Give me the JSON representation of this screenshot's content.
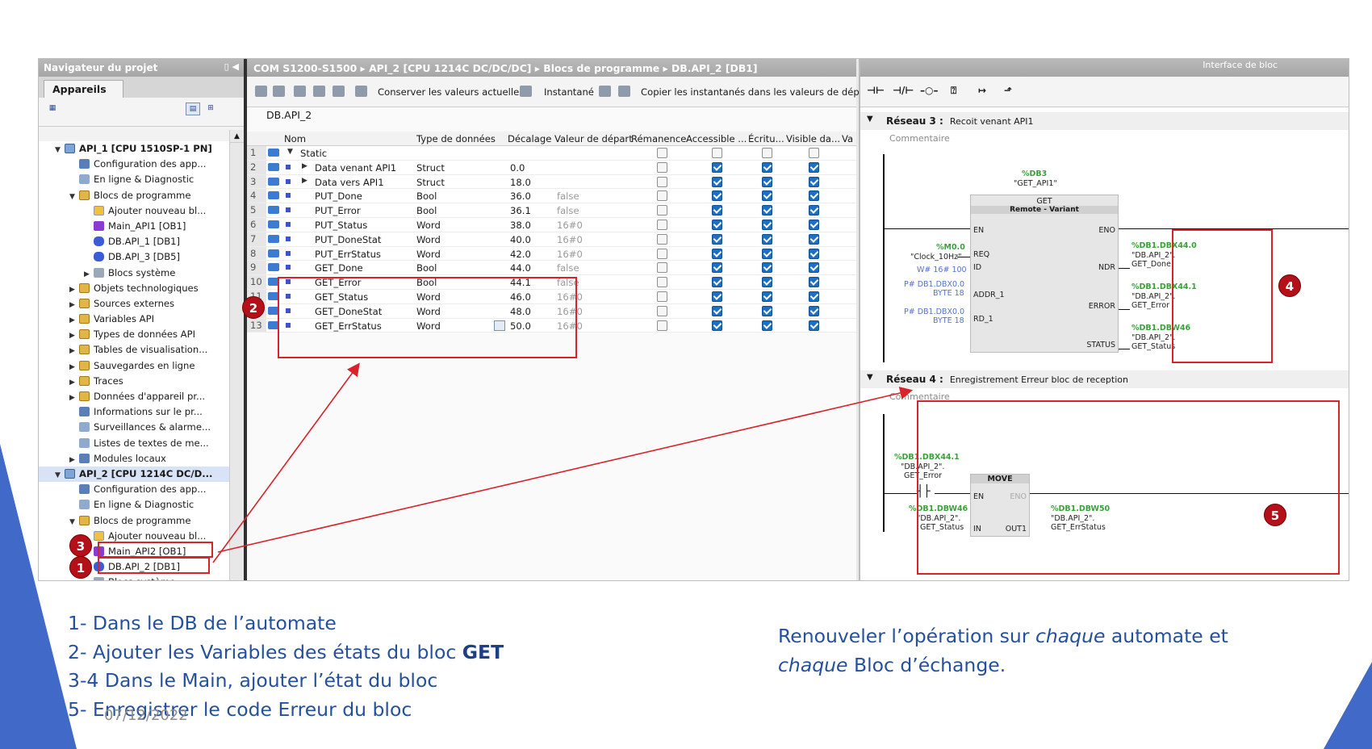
{
  "navigator": {
    "header": "Navigateur du projet",
    "tab": "Appareils",
    "tree": [
      {
        "label": "API_1 [CPU 1510SP-1 PN]",
        "level": 0,
        "icon": "cpu",
        "twisty": "▼"
      },
      {
        "label": "Configuration des app...",
        "level": 1,
        "icon": "cfg",
        "twisty": ""
      },
      {
        "label": "En ligne & Diagnostic",
        "level": 1,
        "icon": "diag",
        "twisty": ""
      },
      {
        "label": "Blocs de programme",
        "level": 1,
        "icon": "fold",
        "twisty": "▼"
      },
      {
        "label": "Ajouter nouveau bl...",
        "level": 2,
        "icon": "add",
        "twisty": ""
      },
      {
        "label": "Main_API1 [OB1]",
        "level": 2,
        "icon": "ob",
        "twisty": ""
      },
      {
        "label": "DB.API_1 [DB1]",
        "level": 2,
        "icon": "db",
        "twisty": ""
      },
      {
        "label": "DB.API_3 [DB5]",
        "level": 2,
        "icon": "db",
        "twisty": ""
      },
      {
        "label": "Blocs système",
        "level": 2,
        "icon": "gray",
        "twisty": "▶"
      },
      {
        "label": "Objets technologiques",
        "level": 1,
        "icon": "fold",
        "twisty": "▶"
      },
      {
        "label": "Sources externes",
        "level": 1,
        "icon": "fold",
        "twisty": "▶"
      },
      {
        "label": "Variables API",
        "level": 1,
        "icon": "fold",
        "twisty": "▶"
      },
      {
        "label": "Types de données API",
        "level": 1,
        "icon": "fold",
        "twisty": "▶"
      },
      {
        "label": "Tables de visualisation...",
        "level": 1,
        "icon": "fold",
        "twisty": "▶"
      },
      {
        "label": "Sauvegardes en ligne",
        "level": 1,
        "icon": "fold",
        "twisty": "▶"
      },
      {
        "label": "Traces",
        "level": 1,
        "icon": "fold",
        "twisty": "▶"
      },
      {
        "label": "Données d'appareil pr...",
        "level": 1,
        "icon": "fold",
        "twisty": "▶"
      },
      {
        "label": "Informations sur le pr...",
        "level": 1,
        "icon": "cfg",
        "twisty": ""
      },
      {
        "label": "Surveillances & alarme...",
        "level": 1,
        "icon": "diag",
        "twisty": ""
      },
      {
        "label": "Listes de textes de me...",
        "level": 1,
        "icon": "diag",
        "twisty": ""
      },
      {
        "label": "Modules locaux",
        "level": 1,
        "icon": "cfg",
        "twisty": "▶"
      },
      {
        "label": "API_2 [CPU 1214C DC/D...",
        "level": 0,
        "icon": "cpu",
        "twisty": "▼",
        "sel": true
      },
      {
        "label": "Configuration des app...",
        "level": 1,
        "icon": "cfg",
        "twisty": ""
      },
      {
        "label": "En ligne & Diagnostic",
        "level": 1,
        "icon": "diag",
        "twisty": ""
      },
      {
        "label": "Blocs de programme",
        "level": 1,
        "icon": "fold",
        "twisty": "▼"
      },
      {
        "label": "Ajouter nouveau bl...",
        "level": 2,
        "icon": "add",
        "twisty": ""
      },
      {
        "label": "Main_API2 [OB1]",
        "level": 2,
        "icon": "ob",
        "twisty": ""
      },
      {
        "label": "DB.API_2 [DB1]",
        "level": 2,
        "icon": "db",
        "twisty": ""
      },
      {
        "label": "Blocs système",
        "level": 2,
        "icon": "gray",
        "twisty": "▶"
      }
    ]
  },
  "editor": {
    "breadcrumb": "COM S1200-S1500  ▸  API_2 [CPU 1214C DC/DC/DC]  ▸  Blocs de programme  ▸  DB.API_2 [DB1]",
    "toolbar": {
      "keep_values": "Conserver les valeurs actuelles",
      "snapshot": "Instantané",
      "copy_snapshots": "Copier les instantanés dans les valeurs de départ"
    },
    "db_title": "DB.API_2",
    "columns": [
      "Nom",
      "Type de données",
      "Décalage",
      "Valeur de départ",
      "Rémanence",
      "Accessible ...",
      "Écritu...",
      "Visible da...",
      "Va"
    ],
    "rows": [
      {
        "n": "1",
        "name": "Static",
        "type": "",
        "offset": "",
        "start": "",
        "tw": "▼",
        "ind": 0
      },
      {
        "n": "2",
        "name": "Data venant API1",
        "type": "Struct",
        "offset": "0.0",
        "start": "",
        "tw": "▶",
        "ind": 1
      },
      {
        "n": "3",
        "name": "Data vers API1",
        "type": "Struct",
        "offset": "18.0",
        "start": "",
        "tw": "▶",
        "ind": 1
      },
      {
        "n": "4",
        "name": "PUT_Done",
        "type": "Bool",
        "offset": "36.0",
        "start": "false",
        "tw": "",
        "ind": 1
      },
      {
        "n": "5",
        "name": "PUT_Error",
        "type": "Bool",
        "offset": "36.1",
        "start": "false",
        "tw": "",
        "ind": 1
      },
      {
        "n": "6",
        "name": "PUT_Status",
        "type": "Word",
        "offset": "38.0",
        "start": "16#0",
        "tw": "",
        "ind": 1
      },
      {
        "n": "7",
        "name": "PUT_DoneStat",
        "type": "Word",
        "offset": "40.0",
        "start": "16#0",
        "tw": "",
        "ind": 1
      },
      {
        "n": "8",
        "name": "PUT_ErrStatus",
        "type": "Word",
        "offset": "42.0",
        "start": "16#0",
        "tw": "",
        "ind": 1
      },
      {
        "n": "9",
        "name": "GET_Done",
        "type": "Bool",
        "offset": "44.0",
        "start": "false",
        "tw": "",
        "ind": 1
      },
      {
        "n": "10",
        "name": "GET_Error",
        "type": "Bool",
        "offset": "44.1",
        "start": "false",
        "tw": "",
        "ind": 1
      },
      {
        "n": "11",
        "name": "GET_Status",
        "type": "Word",
        "offset": "46.0",
        "start": "16#0",
        "tw": "",
        "ind": 1
      },
      {
        "n": "12",
        "name": "GET_DoneStat",
        "type": "Word",
        "offset": "48.0",
        "start": "16#0",
        "tw": "",
        "ind": 1
      },
      {
        "n": "13",
        "name": "GET_ErrStatus",
        "type": "Word",
        "offset": "50.0",
        "start": "16#0",
        "tw": "",
        "ind": 1
      }
    ]
  },
  "ladder": {
    "header": "Interface de bloc",
    "net3": {
      "title": "Réseau 3 :",
      "desc": "Recoit venant API1",
      "comment": "Commentaire",
      "db": "%DB3",
      "inst": "\"GET_API1\"",
      "block": "GET",
      "sub": "Remote  -  Variant",
      "en": "EN",
      "eno": "ENO",
      "req_addr": "%M0.0",
      "req_tag": "\"Clock_10Hz\"",
      "req": "REQ",
      "id_val": "W# 16# 100",
      "id": "ID",
      "addr_val": "P# DB1.DBX0.0",
      "addr_len": "BYTE 18",
      "addr": "ADDR_1",
      "rd_val": "P# DB1.DBX0.0",
      "rd_len": "BYTE 18",
      "rd": "RD_1",
      "ndr": "NDR",
      "error": "ERROR",
      "status": "STATUS",
      "o1a": "%DB1.DBX44.0",
      "o1b": "\"DB.API_2\".",
      "o1c": "GET_Done",
      "o2a": "%DB1.DBX44.1",
      "o2b": "\"DB.API_2\".",
      "o2c": "GET_Error",
      "o3a": "%DB1.DBW46",
      "o3b": "\"DB.API_2\".",
      "o3c": "GET_Status"
    },
    "net4": {
      "title": "Réseau 4 :",
      "desc": "Enregistrement Erreur bloc de reception",
      "comment": "Commentaire",
      "c_addr": "%DB1.DBX44.1",
      "c_tag": "\"DB.API_2\".",
      "c_name": "GET_Error",
      "block": "MOVE",
      "en": "EN",
      "eno": "ENO",
      "in": "IN",
      "out": "OUT1",
      "in_addr": "%DB1.DBW46",
      "in_tag": "\"DB.API_2\".",
      "in_name": "GET_Status",
      "out_addr": "%DB1.DBW50",
      "out_tag": "\"DB.API_2\".",
      "out_name": "GET_ErrStatus"
    }
  },
  "badges": {
    "b1": "1",
    "b2": "2",
    "b3": "3",
    "b4": "4",
    "b5": "5"
  },
  "caption": {
    "l1": "1- Dans le DB de l’automate",
    "l2a": "2- Ajouter les Variables des états du bloc ",
    "l2b": "GET",
    "l3": "3-4 Dans le Main, ajouter l’état du bloc",
    "l4": "5- Enregistrer le code Erreur du bloc"
  },
  "note": {
    "a": "Renouveler l’opération sur ",
    "b": "chaque",
    "c": " automate et",
    "d": "chaque",
    "e": " Bloc d’échange."
  },
  "date": "07/12/2022",
  "colors": {
    "accent": "#24509e",
    "annotation": "#d8232a",
    "badge": "#b3101a"
  }
}
